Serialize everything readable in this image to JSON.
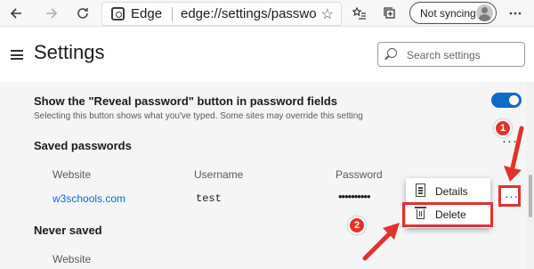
{
  "browser": {
    "site_label": "Edge",
    "address_url": "edge://settings/passwo",
    "sync_label": "Not syncing",
    "icons": {
      "back": "back-arrow-icon",
      "forward": "forward-arrow-icon",
      "refresh": "refresh-icon",
      "favorite": "star-icon",
      "favorites_hub": "favorites-list-icon",
      "collections": "collections-icon",
      "menu": "more-horizontal-icon"
    }
  },
  "header": {
    "title": "Settings",
    "search_placeholder": "Search settings"
  },
  "reveal_setting": {
    "title": "Show the \"Reveal password\" button in password fields",
    "description": "Selecting this button shows what you've typed. Some sites may override this setting",
    "enabled": true
  },
  "saved_passwords": {
    "heading": "Saved passwords",
    "more_label": "···",
    "columns": [
      "Website",
      "Username",
      "Password"
    ],
    "rows": [
      {
        "website": "w3schools.com",
        "username": "test",
        "password": "••••••••••"
      }
    ],
    "row_more_label": "···"
  },
  "context_menu": {
    "items": [
      {
        "label": "Details",
        "icon": "details-icon"
      },
      {
        "label": "Delete",
        "icon": "trash-icon"
      }
    ]
  },
  "never_saved": {
    "heading": "Never saved",
    "columns": [
      "Website"
    ]
  },
  "annotations": {
    "step1": "1",
    "step2": "2"
  },
  "colors": {
    "accent": "#0d6bc9",
    "link": "#0d6bc9",
    "annotation_red": "#e0332c"
  }
}
